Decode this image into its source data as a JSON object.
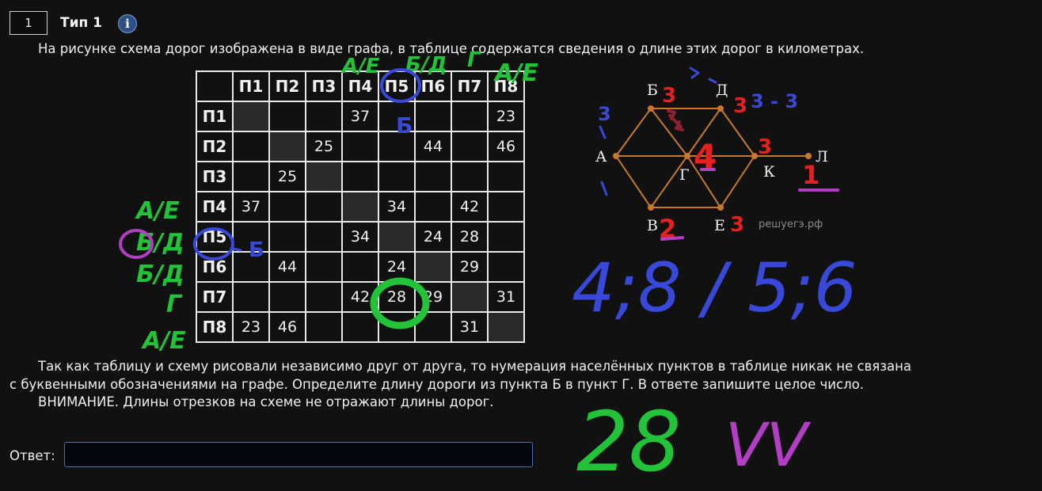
{
  "task": {
    "number": "1",
    "type_label": "Тип 1",
    "info_symbol": "i"
  },
  "text": {
    "intro": "На рисунке схема дорог изображена в виде графа, в таблице содержатся сведения о длине этих дорог в километрах.",
    "paragraph1": "Так как таблицу и схему рисовали независимо друг от друга, то нумерация населённых пунктов в таблице никак не связана",
    "paragraph2": "с буквенными обозначениями на графе. Определите длину дороги из пункта Б в пункт Г. В ответе запишите целое число.",
    "paragraph3": "ВНИМАНИЕ. Длины отрезков на схеме не отражают длины дорог."
  },
  "table": {
    "headers": [
      "П1",
      "П2",
      "П3",
      "П4",
      "П5",
      "П6",
      "П7",
      "П8"
    ],
    "rows": [
      {
        "label": "П1",
        "cells": [
          "",
          "",
          "",
          "37",
          "",
          "",
          "",
          "23"
        ]
      },
      {
        "label": "П2",
        "cells": [
          "",
          "",
          "25",
          "",
          "",
          "44",
          "",
          "46"
        ]
      },
      {
        "label": "П3",
        "cells": [
          "",
          "25",
          "",
          "",
          "",
          "",
          "",
          ""
        ]
      },
      {
        "label": "П4",
        "cells": [
          "37",
          "",
          "",
          "",
          "34",
          "",
          "42",
          ""
        ]
      },
      {
        "label": "П5",
        "cells": [
          "",
          "",
          "",
          "34",
          "",
          "24",
          "28",
          ""
        ]
      },
      {
        "label": "П6",
        "cells": [
          "",
          "44",
          "",
          "",
          "24",
          "",
          "29",
          ""
        ]
      },
      {
        "label": "П7",
        "cells": [
          "",
          "",
          "",
          "42",
          "28",
          "29",
          "",
          "31"
        ]
      },
      {
        "label": "П8",
        "cells": [
          "23",
          "46",
          "",
          "",
          "",
          "",
          "31",
          ""
        ]
      }
    ]
  },
  "graph": {
    "nodes": {
      "A": "А",
      "B": "Б",
      "D": "Д",
      "G": "Г",
      "K": "К",
      "L": "Л",
      "V": "В",
      "E": "Е"
    },
    "watermark": "решуегэ.рф",
    "edge_color": "#c8782a"
  },
  "annotations": {
    "degrees": {
      "B": "3",
      "D": "3",
      "G": "4",
      "K": "3",
      "V": "2",
      "E": "3",
      "L": "1",
      "A_blue": "3"
    },
    "blue_d": "3 - 3",
    "top_green": [
      "А/Е",
      "Б/Д",
      "Г",
      "А/Е"
    ],
    "left_green": [
      "А/Е",
      "Б/Д",
      "Б/Д",
      "Г",
      "А/Е"
    ],
    "blue_b": "Б",
    "big_blue": "4;8 / 5;6",
    "answer_note": "28",
    "answer_marks": "VV",
    "colors": {
      "green": "#22c239",
      "blue": "#3848d8",
      "red": "#e52020",
      "purple": "#b23ec4",
      "maroon": "#8a2230"
    }
  },
  "answer": {
    "label": "Ответ:",
    "value": "",
    "placeholder": ""
  }
}
